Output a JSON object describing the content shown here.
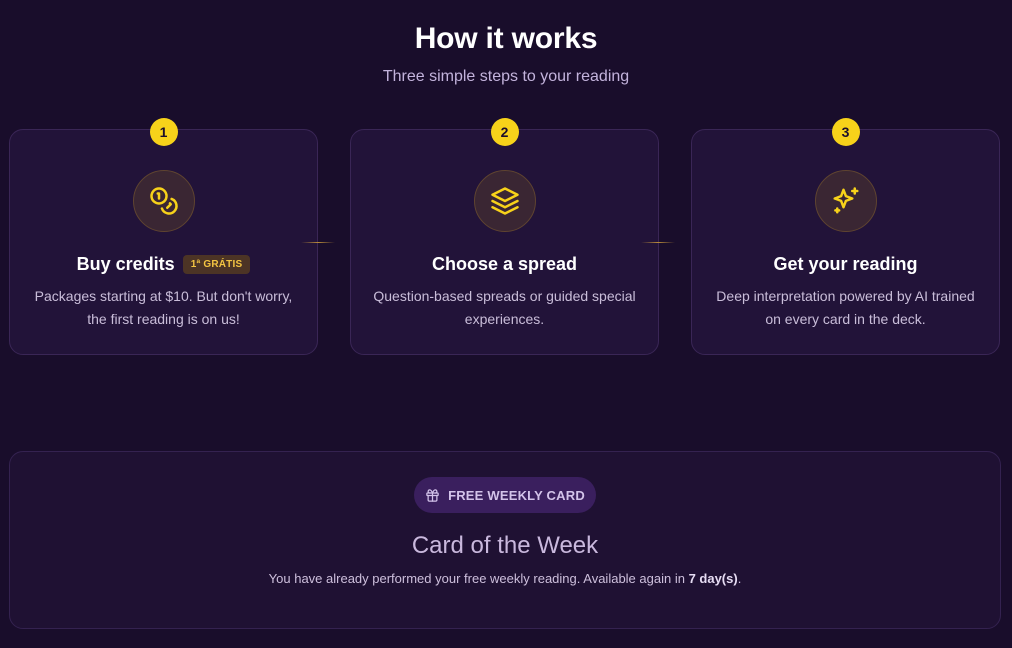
{
  "how_it_works": {
    "title": "How it works",
    "subtitle": "Three simple steps to your reading",
    "steps": [
      {
        "number": "1",
        "icon": "coins-icon",
        "title": "Buy credits",
        "badge": "1ª GRÁTIS",
        "description": "Packages starting at $10. But don't worry, the first reading is on us!"
      },
      {
        "number": "2",
        "icon": "layers-icon",
        "title": "Choose a spread",
        "description": "Question-based spreads or guided special experiences."
      },
      {
        "number": "3",
        "icon": "sparkles-icon",
        "title": "Get your reading",
        "description": "Deep interpretation powered by AI trained on every card in the deck."
      }
    ]
  },
  "weekly_card": {
    "pill_icon": "gift-icon",
    "pill_label": "FREE WEEKLY CARD",
    "title": "Card of the Week",
    "message_prefix": "You have already performed your free weekly reading. Available again in ",
    "message_highlight": "7 day(s)",
    "message_suffix": "."
  },
  "colors": {
    "background": "#190d2b",
    "card": "#221339",
    "accent_yellow": "#f7d21a",
    "badge_text": "#f4c542",
    "pill_bg": "#3a1f5e"
  }
}
